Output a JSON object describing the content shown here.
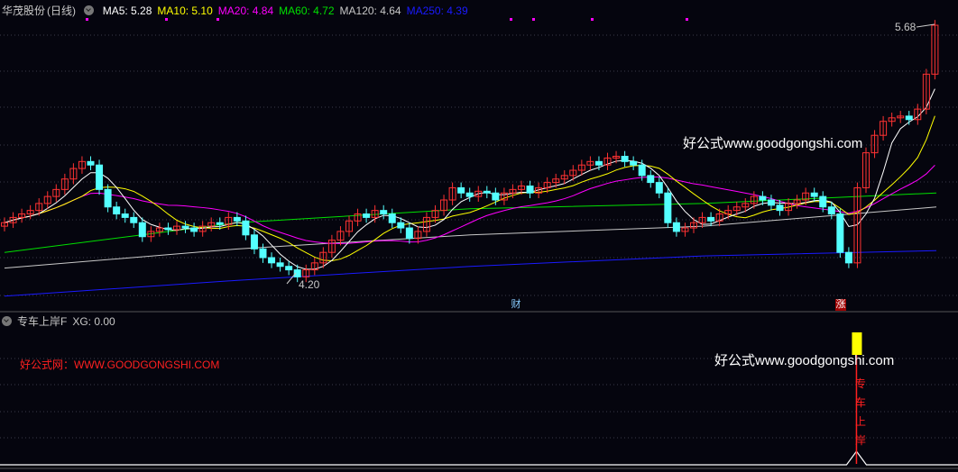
{
  "main_panel": {
    "stock_name": "华茂股份",
    "period": "(日线)",
    "ma_legend": [
      {
        "label": "MA5: 5.28",
        "color": "#ffffff"
      },
      {
        "label": "MA10: 5.10",
        "color": "#ffff00"
      },
      {
        "label": "MA20: 4.84",
        "color": "#ff00ff"
      },
      {
        "label": "MA60: 4.72",
        "color": "#00e000"
      },
      {
        "label": "MA120: 4.64",
        "color": "#c8c8c8"
      },
      {
        "label": "MA250: 4.39",
        "color": "#1a1aff"
      }
    ],
    "high_label": "5.68",
    "low_label": "4.20",
    "watermark": "好公式www.goodgongshi.com",
    "markers": {
      "cai": "财",
      "zhang": "涨"
    }
  },
  "indicator_panel": {
    "name": "专车上岸F",
    "value_label": "XG: 0.00",
    "watermark_red": "好公式网：WWW.GOODGONGSHI.COM",
    "watermark": "好公式www.goodgongshi.com",
    "signal_text": [
      "专",
      "车",
      "上",
      "岸"
    ]
  },
  "colors": {
    "up": "#ff3232",
    "down": "#54ffff",
    "background": "#05050e",
    "signal_bar": "#ffff00"
  },
  "chart_data": {
    "type": "candlestick",
    "price_range": [
      4.05,
      5.75
    ],
    "closes": [
      4.55,
      4.58,
      4.6,
      4.62,
      4.66,
      4.7,
      4.74,
      4.8,
      4.86,
      4.9,
      4.88,
      4.74,
      4.64,
      4.6,
      4.58,
      4.55,
      4.47,
      4.5,
      4.52,
      4.51,
      4.53,
      4.52,
      4.5,
      4.53,
      4.55,
      4.54,
      4.58,
      4.56,
      4.48,
      4.4,
      4.35,
      4.32,
      4.3,
      4.28,
      4.24,
      4.28,
      4.32,
      4.38,
      4.45,
      4.5,
      4.56,
      4.6,
      4.58,
      4.62,
      4.6,
      4.55,
      4.52,
      4.46,
      4.5,
      4.58,
      4.62,
      4.68,
      4.75,
      4.72,
      4.7,
      4.73,
      4.72,
      4.68,
      4.72,
      4.74,
      4.76,
      4.72,
      4.75,
      4.78,
      4.8,
      4.82,
      4.85,
      4.88,
      4.9,
      4.88,
      4.92,
      4.93,
      4.9,
      4.88,
      4.82,
      4.78,
      4.72,
      4.55,
      4.5,
      4.52,
      4.55,
      4.58,
      4.56,
      4.6,
      4.62,
      4.64,
      4.66,
      4.7,
      4.68,
      4.65,
      4.62,
      4.66,
      4.68,
      4.72,
      4.7,
      4.64,
      4.6,
      4.38,
      4.32,
      4.75,
      4.95,
      5.05,
      5.13,
      5.15,
      5.16,
      5.14,
      5.2,
      5.4,
      5.68
    ],
    "ma60_path": [
      4.38,
      4.55,
      4.63,
      4.66,
      4.72
    ],
    "ma120_path": [
      4.29,
      4.4,
      4.48,
      4.53,
      4.64
    ],
    "ma250_path": [
      4.13,
      4.22,
      4.3,
      4.36,
      4.39
    ],
    "signal_index": 99
  }
}
